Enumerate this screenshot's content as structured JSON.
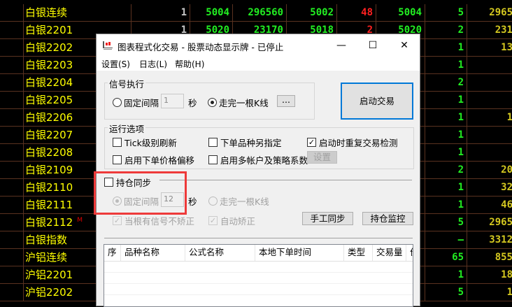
{
  "board": {
    "rows": [
      {
        "name": "白银连续",
        "c1": "1",
        "c2": "5004",
        "c3": "296560",
        "c4": "5002",
        "c5": "48",
        "c6": "5004",
        "c7": "5",
        "c8": "2965"
      },
      {
        "name": "白银2201",
        "c1": "1",
        "c2": "5020",
        "c3": "23170",
        "c4": "5018",
        "c5": "2",
        "c6": "5020",
        "c7": "2",
        "c8": "231"
      },
      {
        "name": "白银2202",
        "c7": "1",
        "c8": "13"
      },
      {
        "name": "白银2203",
        "c7": "1",
        "c8": ""
      },
      {
        "name": "白银2204",
        "c7": "2",
        "c8": ""
      },
      {
        "name": "白银2205",
        "c7": "1",
        "c8": ""
      },
      {
        "name": "白银2206",
        "c7": "1",
        "c8": "1"
      },
      {
        "name": "白银2207",
        "c7": "1",
        "c8": ""
      },
      {
        "name": "白银2208",
        "c7": "1",
        "c8": ""
      },
      {
        "name": "白银2109",
        "c7": "2",
        "c8": "20"
      },
      {
        "name": "白银2110",
        "c7": "1",
        "c8": "32"
      },
      {
        "name": "白银2111",
        "c7": "1",
        "c8": "46"
      },
      {
        "name": "白银2112",
        "mark": "M",
        "c7": "5",
        "c8": "2965"
      },
      {
        "name": "白银指数",
        "c7": "—",
        "c8": "3312"
      },
      {
        "name": "沪铝连续",
        "c7": "65",
        "c8": "855"
      },
      {
        "name": "沪铝2201",
        "c7": "1",
        "c8": "18"
      },
      {
        "name": "沪铝2202",
        "c7": "5",
        "c8": "1"
      }
    ]
  },
  "dialog": {
    "title": "图表程式化交易 - 股票动态显示牌 - 已停止",
    "menu": [
      "设置(S)",
      "日志(L)",
      "帮助(H)"
    ],
    "signal": {
      "title": "信号执行",
      "fixed": "固定间隔",
      "interval": "1",
      "sec": "秒",
      "bar": "走完一根K线",
      "more": "...",
      "selected": "bar"
    },
    "start_button": "启动交易",
    "options": {
      "title": "运行选项",
      "tick": "Tick级别刷新",
      "tick_checked": false,
      "alt_symbol": "下单品种另指定",
      "alt_checked": false,
      "recheck": "启动时重复交易检测",
      "recheck_checked": true,
      "offset": "启用下单价格偏移",
      "offset_checked": false,
      "multi": "启用多帐户及策略系数",
      "multi_checked": false,
      "settings": "设置"
    },
    "sync": {
      "title": "持仓同步",
      "checked": false,
      "fixed": "固定间隔",
      "interval": "12",
      "sec": "秒",
      "bar": "走完一根K线",
      "nocorrect": "当根有信号不矫正",
      "auto": "自动矫正",
      "manual": "手工同步",
      "monitor": "持仓监控"
    },
    "list": {
      "columns": [
        "序",
        "品种名称",
        "公式名称",
        "本地下单时间",
        "类型",
        "交易量",
        "价"
      ]
    }
  }
}
